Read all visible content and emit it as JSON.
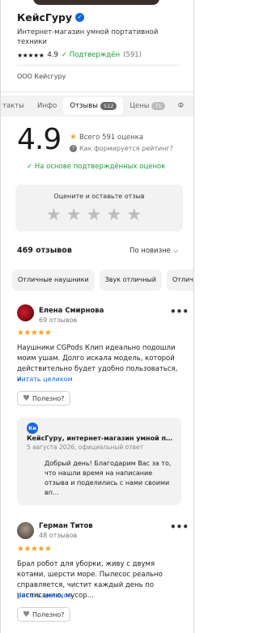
{
  "header": {
    "seller_name": "КейсГуру",
    "verified_icon": "check-badge-icon",
    "description": "Интернет-магазин умной портативной техники",
    "stars": "★★★★★",
    "rating": "4.9",
    "confirmed_label": "✓ Подтверждён",
    "reviews_count": "(591)",
    "legal_name": "ООО Кейсгуру"
  },
  "tabs": [
    {
      "label": "такты"
    },
    {
      "label": "Инфо"
    },
    {
      "label": "Отзывы",
      "badge": "512"
    },
    {
      "label": "Цены",
      "badge": "71"
    },
    {
      "label": "Ф"
    }
  ],
  "summary": {
    "rating": "4.9",
    "total_label": "Всего 591 оценка",
    "how_label": "Как формируется рейтинг?",
    "based_label": "✓ На основе подтверждённых оценок"
  },
  "rate_box": {
    "title": "Оцените и оставьте отзыв",
    "star": "★"
  },
  "list": {
    "count_label": "469 отзывов",
    "sort_label": "По новизне",
    "sort_icon": "chevron-down-icon"
  },
  "chips": [
    "Отличные наушники",
    "Звук отличный",
    "Отлич"
  ],
  "reviews": [
    {
      "name": "Елена Смирнова",
      "sub": "69 отзывов",
      "more": "•••",
      "stars": "★★★★★",
      "text": "Наушники CGPods Клип идеально подошли моим ушам. Долго искала модель, которой действительно будет удобно пользоваться, и…",
      "read_more": "Читать целиком",
      "helpful": "Полезно?"
    },
    {
      "name": "Герман Титов",
      "sub": "48 отзывов",
      "more": "•••",
      "stars": "★★★★★",
      "text": "Брал робот для уборки, живу с двумя котами, шерсти море. Пылесос реально справляется, чистит каждый день по расписанию, мусор…",
      "read_more": "Читать целиком",
      "helpful": "Полезно?"
    }
  ],
  "reply": {
    "avatar": "Ки",
    "name": "КейсГуру, интернет-магазин умной по…",
    "date": "5 августа 2026, официальный ответ",
    "text": "Добрый день! Благодарим Вас за то, что нашли время на написание отзыва и поделились с нами своими вп…"
  },
  "colors": {
    "accent_blue": "#1565e8",
    "confirm_green": "#1d9a3a",
    "star_orange": "#f5a623"
  }
}
